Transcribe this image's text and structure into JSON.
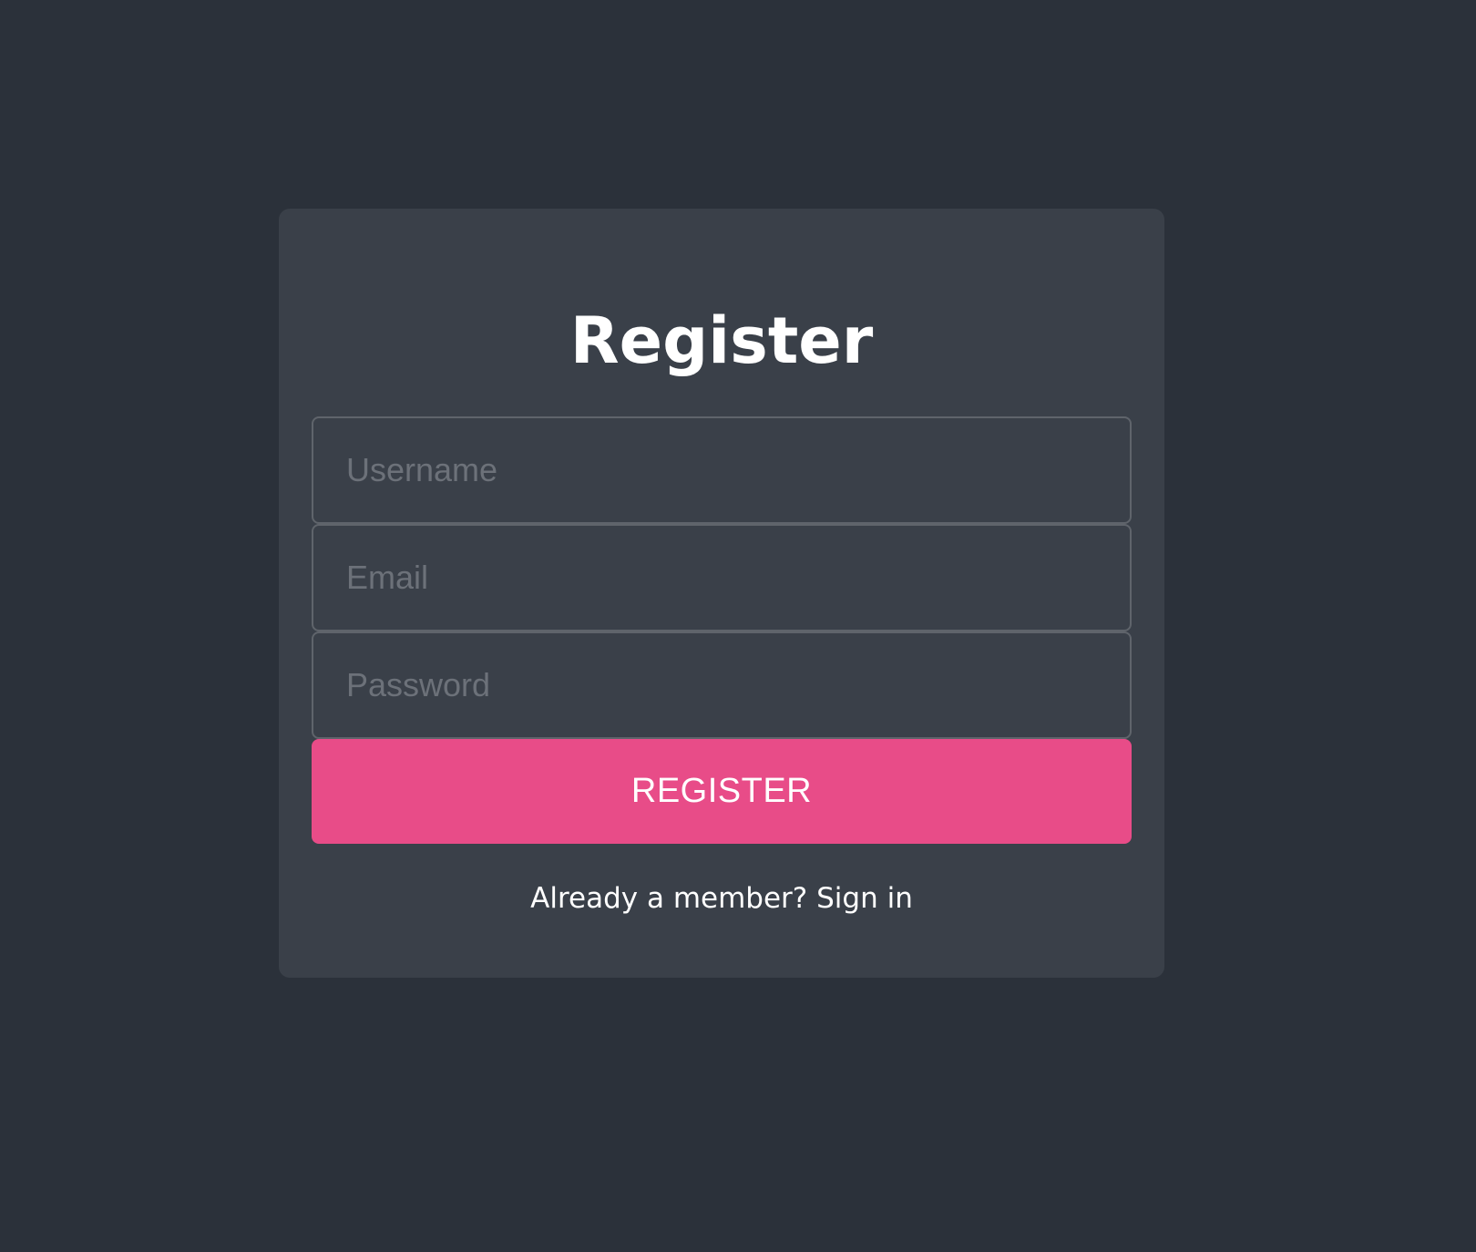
{
  "form": {
    "title": "Register",
    "username": {
      "placeholder": "Username",
      "value": ""
    },
    "email": {
      "placeholder": "Email",
      "value": ""
    },
    "password": {
      "placeholder": "Password",
      "value": ""
    },
    "submit_label": "REGISTER",
    "signin_link": "Already a member? Sign in"
  },
  "colors": {
    "background": "#2b313a",
    "card": "#3a4049",
    "accent": "#e84c88",
    "input_border": "#5f646b",
    "placeholder": "#6c7179",
    "text": "#ffffff"
  }
}
